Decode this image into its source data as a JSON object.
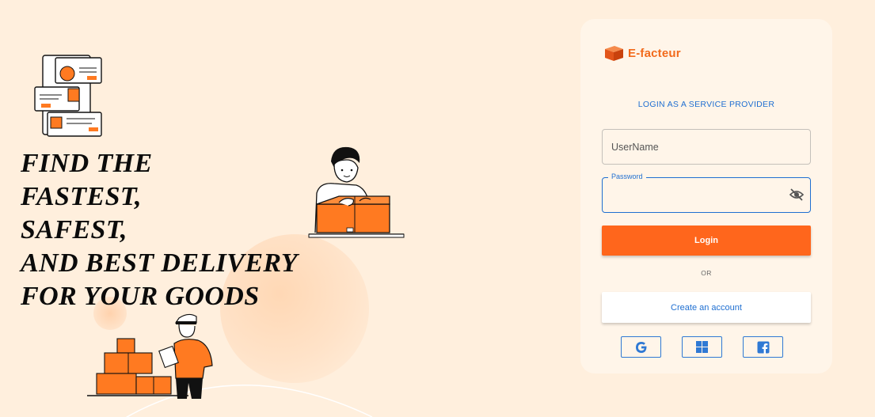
{
  "headline": {
    "lines": [
      "FIND THE",
      "FASTEST,",
      "SAFEST,",
      "AND BEST DELIVERY",
      "FOR YOUR GOODS"
    ]
  },
  "brand": {
    "name": "E-facteur",
    "icon": "cube-logo-icon",
    "color": "#f26a1b"
  },
  "login_card": {
    "subtitle": "LOGIN AS A SERVICE PROVIDER",
    "username": {
      "placeholder": "UserName",
      "value": ""
    },
    "password": {
      "label": "Password",
      "value": "",
      "toggle_icon": "eye-off-icon"
    },
    "login_button": "Login",
    "divider_text": "OR",
    "create_account_button": "Create an account",
    "social_buttons": [
      {
        "name": "google",
        "icon": "google-icon"
      },
      {
        "name": "windows",
        "icon": "windows-icon"
      },
      {
        "name": "facebook",
        "icon": "facebook-icon"
      }
    ]
  },
  "colors": {
    "background": "#ffefdd",
    "accent": "#ff661c",
    "link": "#1f6fd1",
    "card": "#fff5e9"
  }
}
